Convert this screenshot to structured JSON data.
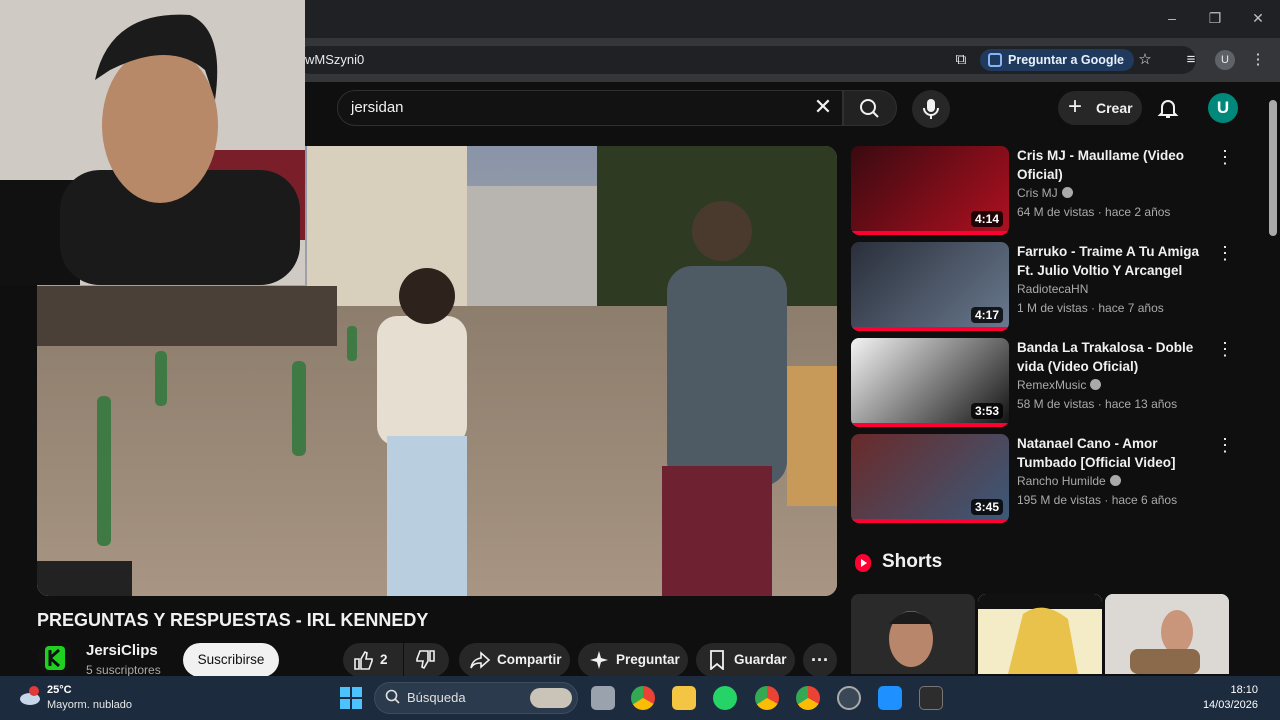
{
  "browser": {
    "url_fragment": "wMSzyni0",
    "ask_google_label": "Preguntar a Google",
    "profile_initial": "U",
    "window_controls": [
      "–",
      "❐",
      "✕"
    ]
  },
  "youtube_header": {
    "search_value": "jersidan",
    "create_label": "Crear",
    "avatar_initial": "U"
  },
  "video": {
    "title": "PREGUNTAS Y RESPUESTAS - IRL KENNEDY",
    "channel": "JersiClips",
    "subscribers": "5 suscriptores",
    "subscribe_label": "Suscribirse",
    "likes": "2",
    "share_label": "Compartir",
    "ask_label": "Preguntar",
    "save_label": "Guardar"
  },
  "related": [
    {
      "title": "Cris MJ - Maullame (Video Oficial)",
      "channel": "Cris MJ",
      "verified": true,
      "meta": "64 M de vistas · hace 2 años",
      "duration": "4:14"
    },
    {
      "title": "Farruko - Traime A Tu Amiga Ft. Julio Voltio Y Arcangel",
      "channel": "RadiotecaHN",
      "verified": false,
      "meta": "1 M de vistas · hace 7 años",
      "duration": "4:17"
    },
    {
      "title": "Banda La Trakalosa - Doble vida (Video Oficial)",
      "channel": "RemexMusic",
      "verified": true,
      "meta": "58 M de vistas · hace 13 años",
      "duration": "3:53"
    },
    {
      "title": "Natanael Cano - Amor Tumbado [Official Video]",
      "channel": "Rancho Humilde",
      "verified": true,
      "meta": "195 M de vistas · hace 6 años",
      "duration": "3:45"
    }
  ],
  "shorts_label": "Shorts",
  "taskbar": {
    "weather_temp": "25°C",
    "weather_desc": "Mayorm. nublado",
    "search_placeholder": "Búsqueda",
    "time": "18:10",
    "date": "14/03/2026"
  }
}
